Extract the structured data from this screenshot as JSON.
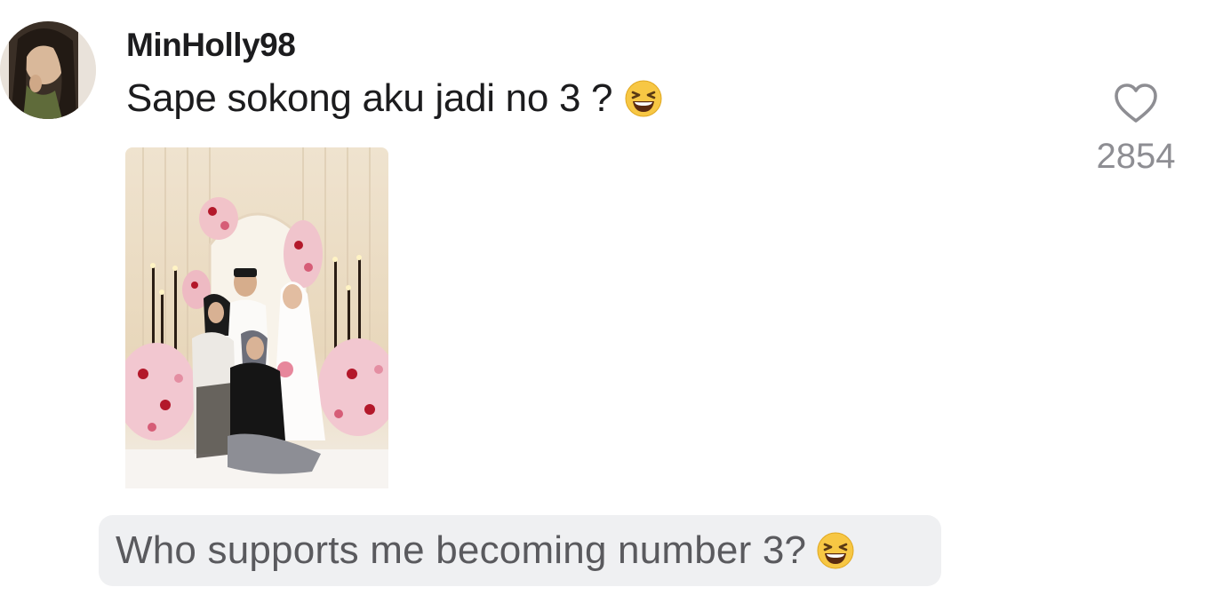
{
  "comment": {
    "username": "MinHolly98",
    "text": "Sape sokong aku jadi no 3 ?",
    "emoji": "grinning-squinting-face",
    "likes": "2854",
    "avatar_icon": "avatar-photo",
    "like_icon": "heart-outline-icon"
  },
  "translation": {
    "text": "Who supports me becoming number 3?",
    "emoji": "grinning-squinting-face"
  },
  "colors": {
    "text": "#1c1c1e",
    "muted": "#8e8e93",
    "translation_bg": "#eff0f2",
    "emoji_yellow": "#f7c744"
  }
}
